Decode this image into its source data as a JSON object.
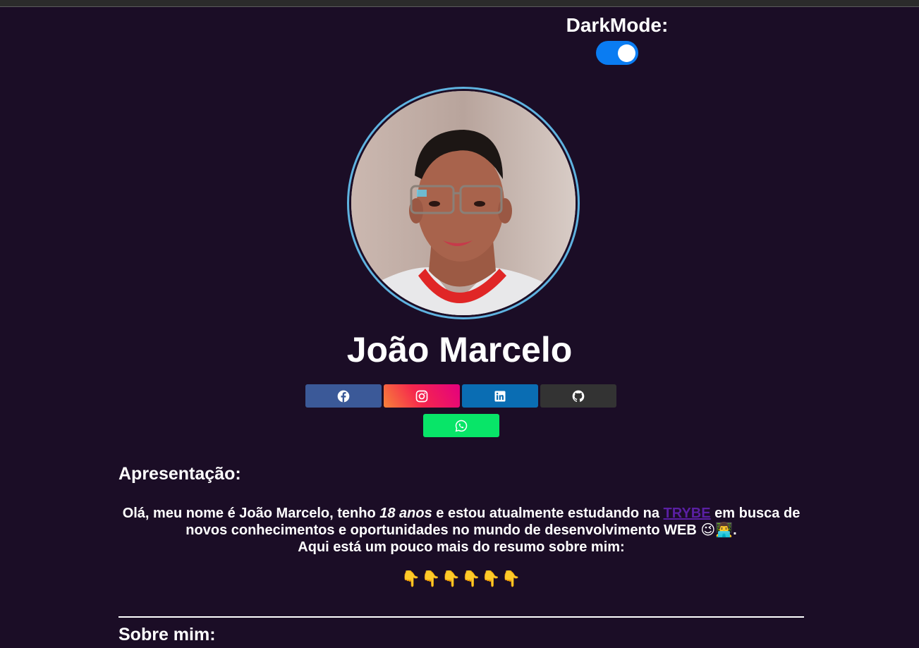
{
  "darkmode": {
    "label": "DarkMode:",
    "enabled": true,
    "accent_color": "#0a7cf2"
  },
  "profile": {
    "name": "João Marcelo"
  },
  "social_links": [
    {
      "name": "facebook",
      "icon": "facebook-icon",
      "color": "#3b5998"
    },
    {
      "name": "instagram",
      "icon": "instagram-icon",
      "color": "#e1306c"
    },
    {
      "name": "linkedin",
      "icon": "linkedin-icon",
      "color": "#0a6db3"
    },
    {
      "name": "github",
      "icon": "github-icon",
      "color": "#333333"
    },
    {
      "name": "whatsapp",
      "icon": "whatsapp-icon",
      "color": "#08e568"
    }
  ],
  "presentation": {
    "title": "Apresentação:",
    "intro_part1": "Olá, meu nome é João Marcelo, tenho ",
    "age": "18 anos",
    "intro_part2": " e estou atualmente estudando na ",
    "link_text": "TRYBE",
    "intro_part3": " em busca de novos conhecimentos e oportunidades no mundo de desenvolvimento WEB 😉👨‍💻.",
    "line2": "Aqui está um pouco mais do resumo sobre mim:",
    "pointers": "👇👇👇👇👇👇"
  },
  "about": {
    "title": "Sobre mim:"
  },
  "colors": {
    "background": "#1b0d26",
    "text": "#ffffff",
    "link": "#5a1fa3",
    "avatar_border": "#5fb3e0"
  }
}
